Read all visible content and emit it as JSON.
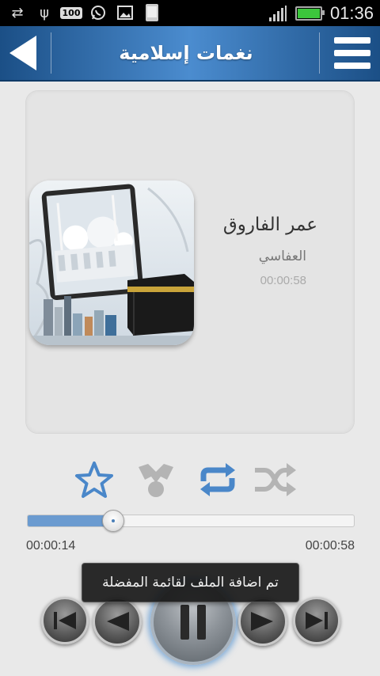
{
  "status_bar": {
    "time": "01:36",
    "battery_badge": "100",
    "left_icons": [
      "sync-icon",
      "usb-icon",
      "battery-badge-icon",
      "whatsapp-icon",
      "image-icon",
      "app-notification-icon"
    ],
    "right_icons": [
      "signal-icon",
      "battery-icon"
    ]
  },
  "header": {
    "title": "نغمات إسلامية",
    "back_icon": "back-arrow-icon",
    "menu_icon": "hamburger-menu-icon"
  },
  "track": {
    "title": "عمر الفاروق",
    "artist": "العفاسي",
    "duration": "00:00:58"
  },
  "actions": {
    "favorite_icon": "star-icon",
    "share_icon": "share-icon",
    "repeat_icon": "repeat-icon",
    "shuffle_icon": "shuffle-icon"
  },
  "player": {
    "current_time": "00:00:14",
    "total_time": "00:00:58",
    "progress_fraction": 0.26
  },
  "toast": {
    "message": "تم اضافة الملف لقائمة المفضلة"
  },
  "colors": {
    "header_blue": "#2f6db0",
    "accent_blue": "#4a87c9",
    "disabled_gray": "#b4b4b4",
    "background": "#e9e9e9"
  }
}
